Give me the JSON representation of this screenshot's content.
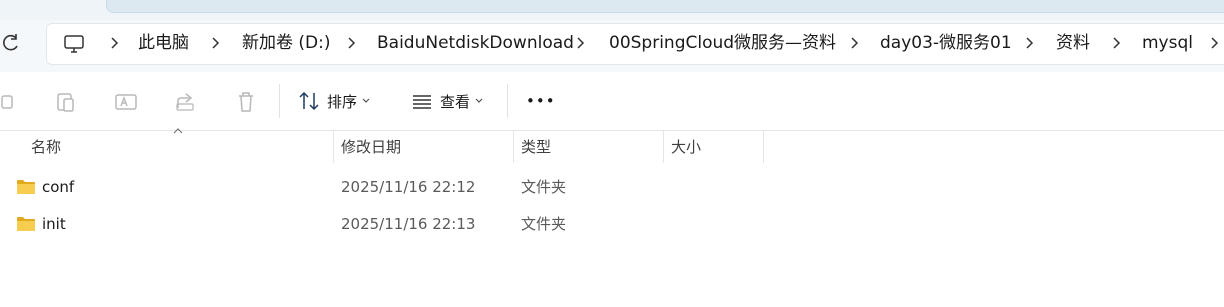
{
  "nav": {
    "breadcrumbs": [
      {
        "label": "此电脑"
      },
      {
        "label": "新加卷 (D:)"
      },
      {
        "label": "BaiduNetdiskDownload"
      },
      {
        "label": "00SpringCloud微服务—资料"
      },
      {
        "label": "day03-微服务01"
      },
      {
        "label": "资料"
      },
      {
        "label": "mysql"
      }
    ]
  },
  "toolbar": {
    "sort_label": "排序",
    "view_label": "查看",
    "more_label": "•••",
    "icons": [
      "copy-icon",
      "paste-icon",
      "rename-icon",
      "share-icon",
      "delete-icon",
      "sort-icon",
      "view-icon",
      "more-icon"
    ]
  },
  "columns": {
    "name": "名称",
    "date": "修改日期",
    "type": "类型",
    "size": "大小"
  },
  "files": [
    {
      "name": "conf",
      "date": "2025/11/16 22:12",
      "type": "文件夹",
      "size": ""
    },
    {
      "name": "init",
      "date": "2025/11/16 22:13",
      "type": "文件夹",
      "size": ""
    }
  ],
  "colors": {
    "folder": "#f4c542",
    "folder_dark": "#e2ab1f",
    "accent": "#0067c0"
  }
}
